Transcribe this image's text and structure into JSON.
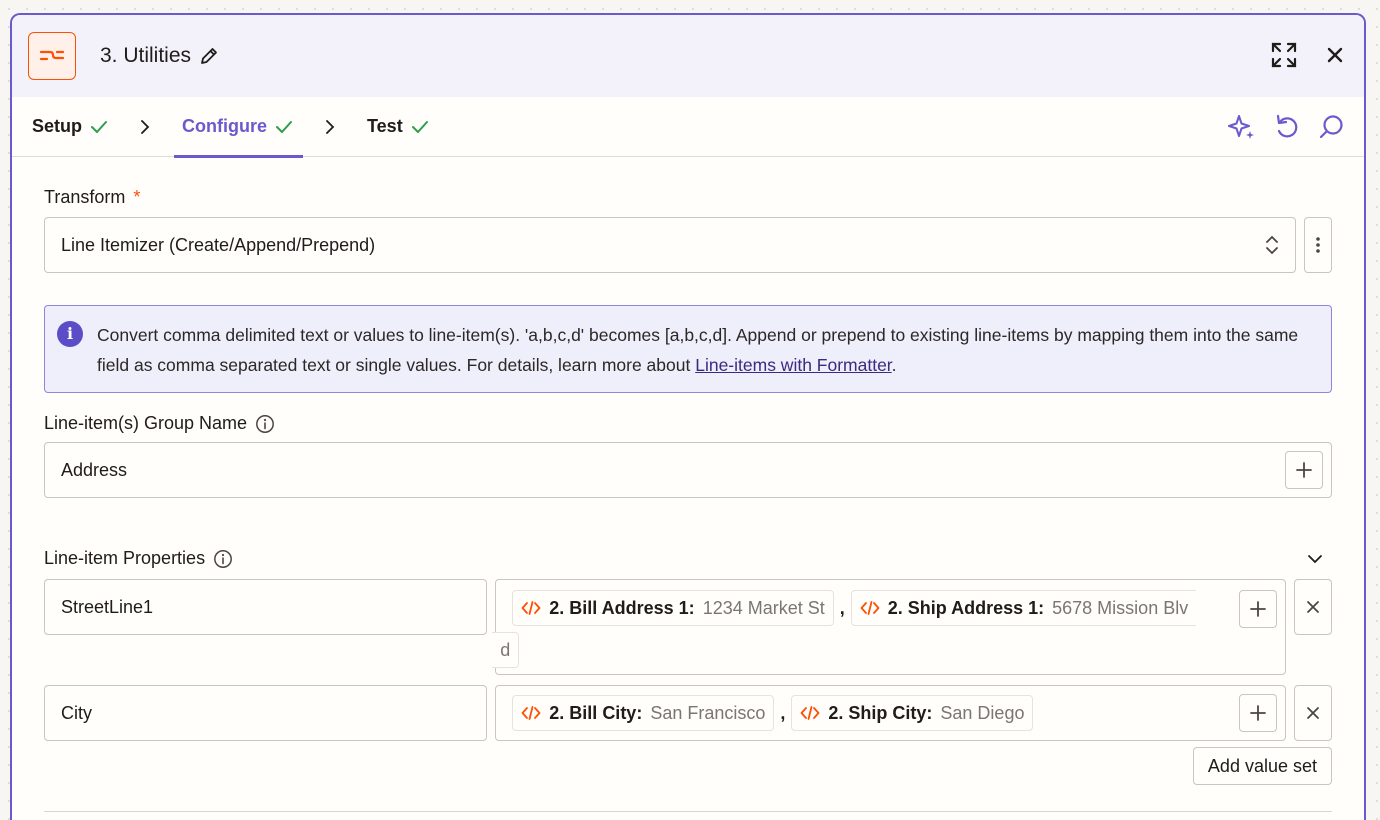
{
  "header": {
    "title": "3. Utilities",
    "icons": [
      "formatter-icon",
      "edit-icon",
      "expand-icon",
      "close-icon"
    ],
    "brand_color": "#ff4f00",
    "accent_color": "#6a5acd"
  },
  "tabs": [
    {
      "label": "Setup",
      "complete": true
    },
    {
      "label": "Configure",
      "complete": true,
      "active": true
    },
    {
      "label": "Test",
      "complete": true
    }
  ],
  "tools": [
    "ai-sparkle-icon",
    "undo-icon",
    "search-icon"
  ],
  "transform": {
    "label": "Transform",
    "required_mark": "*",
    "value": "Line Itemizer (Create/Append/Prepend)"
  },
  "info": {
    "text": "Convert comma delimited text or values to line-item(s). 'a,b,c,d' becomes [a,b,c,d]. Append or prepend to existing line-items by mapping them into the same field as comma separated text or single values. For details, learn more about ",
    "link": "Line-items with Formatter",
    "after": "."
  },
  "group_name": {
    "label": "Line-item(s) Group Name",
    "value": "Address"
  },
  "properties": {
    "label": "Line-item Properties",
    "rows": [
      {
        "key": "StreetLine1",
        "pills": [
          {
            "field": "2. Bill Address 1:",
            "sample": "1234 Market St"
          },
          {
            "field": "2. Ship Address 1:",
            "sample": "5678 Mission Blv"
          }
        ],
        "overflow": "d"
      },
      {
        "key": "City",
        "pills": [
          {
            "field": "2. Bill City:",
            "sample": "San Francisco"
          },
          {
            "field": "2. Ship City:",
            "sample": "San Diego"
          }
        ]
      }
    ],
    "separator": ",",
    "add_value_set": "Add value set"
  }
}
